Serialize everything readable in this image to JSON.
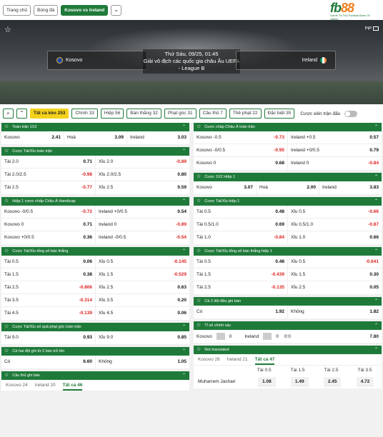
{
  "nav": {
    "home": "Trang chủ",
    "football": "Bóng đá",
    "match": "Kosovo vs Ireland"
  },
  "logo": {
    "brand": "fb88",
    "brand_a": "fb",
    "brand_b": "88",
    "tagline": "Game Tá Thủ  Football Bank Of Online"
  },
  "hero": {
    "datetime": "Thứ Sáu, 09/25, 01:45",
    "competition": "Giải vô địch các quốc gia châu Âu UEFA - League B",
    "home": "Kosovo",
    "away": "Ireland",
    "pip_label": "PiP"
  },
  "filters": [
    {
      "label": "Tất cả kèo 253",
      "on": true
    },
    {
      "label": "Chính 33",
      "on": false
    },
    {
      "label": "Hiệp 56",
      "on": false
    },
    {
      "label": "Bàn thắng 32",
      "on": false
    },
    {
      "label": "Phạt góc 31",
      "on": false
    },
    {
      "label": "Cầu thủ 7",
      "on": false
    },
    {
      "label": "Thẻ phạt 22",
      "on": false
    },
    {
      "label": "Đặc biệt 35",
      "on": false
    }
  ],
  "toggle_label": "Cược xiên trận đấu",
  "left": [
    {
      "title": "Toàn trận 1X2",
      "rows": [
        [
          [
            "Kosovo",
            "2.41"
          ],
          [
            "Hoà",
            "3.09"
          ],
          [
            "Ireland",
            "3.03"
          ]
        ]
      ]
    },
    {
      "title": "Cược Tài/Xỉu toàn trận",
      "rows": [
        [
          [
            "Tài 2.0",
            "0.71"
          ],
          [
            "Xỉu 2.0",
            "-0.89"
          ]
        ],
        [
          [
            "Tài 2.0/2.5",
            "-0.98"
          ],
          [
            "Xỉu 2.0/2.5",
            "0.80"
          ]
        ],
        [
          [
            "Tài 2.5",
            "-0.77"
          ],
          [
            "Xỉu 2.5",
            "0.59"
          ]
        ]
      ]
    },
    {
      "title": "Hiệp 1 cược chấp Châu Á Handicap",
      "rows": [
        [
          [
            "Kosovo -0/0.5",
            "-0.72"
          ],
          [
            "Ireland +0/0.5",
            "0.54"
          ]
        ],
        [
          [
            "Kosovo 0",
            "0.71"
          ],
          [
            "Ireland 0",
            "-0.89"
          ]
        ],
        [
          [
            "Kosovo +0/0.5",
            "0.36"
          ],
          [
            "Ireland -0/0.5",
            "-0.54"
          ]
        ]
      ]
    },
    {
      "title": "Cược Tài/Xỉu tổng số bàn thắng",
      "rows": [
        [
          [
            "Tài 0.5",
            "0.06"
          ],
          [
            "Xỉu 0.5",
            "-0.145"
          ]
        ],
        [
          [
            "Tài 1.5",
            "0.38"
          ],
          [
            "Xỉu 1.5",
            "-0.529"
          ]
        ],
        [
          [
            "Tài 2.5",
            "-0.806"
          ],
          [
            "Xỉu 2.5",
            "0.63"
          ]
        ],
        [
          [
            "Tài 3.5",
            "-0.314"
          ],
          [
            "Xỉu 3.5",
            "0.20"
          ]
        ],
        [
          [
            "Tài 4.5",
            "-0.139"
          ],
          [
            "Xỉu 4.5",
            "0.06"
          ]
        ]
      ]
    },
    {
      "title": "Cược Tài/Xỉu số quả phạt góc toàn trận",
      "rows": [
        [
          [
            "Tài 9.0",
            "0.93"
          ],
          [
            "Xỉu 9.0",
            "0.85"
          ]
        ]
      ]
    },
    {
      "title": "Cả hai đội ghi từ 2 bàn trở lên",
      "rows": [
        [
          [
            "Có",
            "6.60"
          ],
          [
            "Không",
            "1.05"
          ]
        ]
      ]
    },
    {
      "title": "Cầu thủ ghi bàn",
      "tabs": [
        "Kosovo 24",
        "Ireland 20",
        "Tất cả 46"
      ]
    }
  ],
  "right": [
    {
      "title": "Cược chấp Châu Á toàn trận",
      "rows": [
        [
          [
            "Kosovo -0.5",
            "-0.73"
          ],
          [
            "Ireland +0.5",
            "0.57"
          ]
        ],
        [
          [
            "Kosovo -0/0.5",
            "-0.95"
          ],
          [
            "Ireland +0/0.5",
            "0.79"
          ]
        ],
        [
          [
            "Kosovo 0",
            "0.68"
          ],
          [
            "Ireland 0",
            "-0.84"
          ]
        ]
      ]
    },
    {
      "title": "Cược 1X2 Hiệp 1",
      "rows": [
        [
          [
            "Kosovo",
            "3.07"
          ],
          [
            "Hoà",
            "2.00"
          ],
          [
            "Ireland",
            "3.83"
          ]
        ]
      ]
    },
    {
      "title": "Cược Tài/Xỉu hiệp 1",
      "rows": [
        [
          [
            "Tài 0.5",
            "0.48"
          ],
          [
            "Xỉu 0.5",
            "-0.66"
          ]
        ],
        [
          [
            "Tài 0.5/1.0",
            "0.69"
          ],
          [
            "Xỉu 0.5/1.0",
            "-0.87"
          ]
        ],
        [
          [
            "Tài 1.0",
            "-0.84"
          ],
          [
            "Xỉu 1.0",
            "0.66"
          ]
        ]
      ]
    },
    {
      "title": "Cược Tài/Xỉu tổng số bàn thắng hiệp 1",
      "rows": [
        [
          [
            "Tài 0.5",
            "0.48"
          ],
          [
            "Xỉu 0.5",
            "-0.641"
          ]
        ],
        [
          [
            "Tài 1.5",
            "-0.439"
          ],
          [
            "Xỉu 1.5",
            "0.30"
          ]
        ],
        [
          [
            "Tài 2.5",
            "-0.135"
          ],
          [
            "Xỉu 2.5",
            "0.05"
          ]
        ]
      ]
    },
    {
      "title": "Cả 2 đội đều ghi bàn",
      "rows": [
        [
          [
            "Có",
            "1.92"
          ],
          [
            "Không",
            "1.82"
          ]
        ]
      ]
    },
    {
      "title": "Tỉ số chính xác",
      "score": {
        "home": "Kosovo",
        "home_val": "0",
        "away": "Ireland",
        "away_val": "0",
        "odds_label": "0:0",
        "odds": "7.80"
      }
    },
    {
      "title": "Not translated",
      "tabs": [
        "Kosovo 26",
        "Ireland 21",
        "Tất cả 47"
      ],
      "cols": [
        "Tài 0.5",
        "Tài 1.5",
        "Tài 2.5",
        "Tài 3.5"
      ],
      "player": "Muharrem Jashari",
      "odds": [
        "1.08",
        "1.49",
        "2.45",
        "4.72"
      ]
    }
  ]
}
